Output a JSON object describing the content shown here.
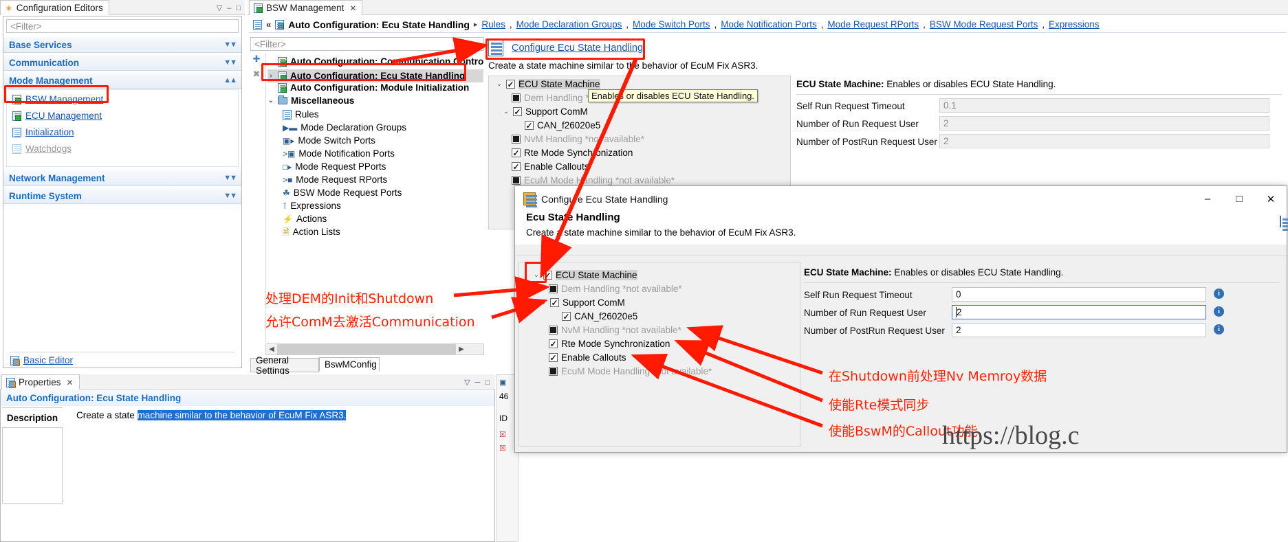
{
  "app": {
    "watermark": "https://blog.c"
  },
  "config_editors_view": {
    "tab_label": "Configuration Editors",
    "tab_icon": "star-icon",
    "filter_placeholder": "<Filter>",
    "minimize_label": "–",
    "maximize_label": "□",
    "menu_label": "▽",
    "categories": [
      {
        "label": "Base Services",
        "expanded": false
      },
      {
        "label": "Communication",
        "expanded": false
      },
      {
        "label": "Mode Management",
        "expanded": true
      },
      {
        "label": "Network Management",
        "expanded": false
      },
      {
        "label": "Runtime System",
        "expanded": false
      }
    ],
    "mode_management_items": [
      {
        "label": "BSW Management",
        "icon": "bsw-management-icon",
        "enabled": true,
        "highlighted": true
      },
      {
        "label": "ECU Management",
        "icon": "ecu-management-icon",
        "enabled": true,
        "highlighted": false
      },
      {
        "label": "Initialization",
        "icon": "initialization-icon",
        "enabled": true,
        "highlighted": false
      },
      {
        "label": "Watchdogs",
        "icon": "watchdogs-icon",
        "enabled": false,
        "highlighted": false
      }
    ],
    "basic_editor_label": "Basic Editor"
  },
  "editor": {
    "tab_label": "BSW Management",
    "tab_icon": "bsw-management-icon",
    "breadcrumb": {
      "back_label": "«",
      "title": "Auto Configuration: Ecu State Handling",
      "separator": "▸",
      "links": [
        "Rules",
        "Mode Declaration Groups",
        "Mode Switch Ports",
        "Mode Notification Ports",
        "Mode Request RPorts",
        "BSW Mode Request Ports",
        "Expressions"
      ]
    },
    "filter_placeholder": "<Filter>",
    "toolbar": {
      "add_label": "✚",
      "delete_label": "✖"
    },
    "tree": [
      {
        "label": "Auto Configuration: Communication Control",
        "icon": "auto-config-icon",
        "bold": true,
        "indent": 0,
        "twisty": "",
        "selected": false
      },
      {
        "label": "Auto Configuration: Ecu State Handling",
        "icon": "auto-config-icon",
        "bold": true,
        "indent": 0,
        "twisty": "›",
        "selected": true
      },
      {
        "label": "Auto Configuration: Module Initialization",
        "icon": "auto-config-icon",
        "bold": true,
        "indent": 0,
        "twisty": "",
        "selected": false
      },
      {
        "label": "Miscellaneous",
        "icon": "folder-icon",
        "bold": true,
        "indent": 0,
        "twisty": "⌄",
        "selected": false
      },
      {
        "label": "Rules",
        "icon": "rules-icon",
        "bold": false,
        "indent": 1,
        "twisty": "",
        "selected": false
      },
      {
        "label": "Mode Declaration Groups",
        "icon": "mode-declaration-groups-icon",
        "bold": false,
        "indent": 1,
        "twisty": "",
        "selected": false
      },
      {
        "label": "Mode Switch Ports",
        "icon": "mode-switch-ports-icon",
        "bold": false,
        "indent": 1,
        "twisty": "",
        "selected": false
      },
      {
        "label": "Mode Notification Ports",
        "icon": "mode-notification-ports-icon",
        "bold": false,
        "indent": 1,
        "twisty": "",
        "selected": false
      },
      {
        "label": "Mode Request PPorts",
        "icon": "mode-request-pports-icon",
        "bold": false,
        "indent": 1,
        "twisty": "",
        "selected": false
      },
      {
        "label": "Mode Request RPorts",
        "icon": "mode-request-rports-icon",
        "bold": false,
        "indent": 1,
        "twisty": "",
        "selected": false
      },
      {
        "label": "BSW Mode Request Ports",
        "icon": "bsw-mode-request-ports-icon",
        "bold": false,
        "indent": 1,
        "twisty": "",
        "selected": false
      },
      {
        "label": "Expressions",
        "icon": "expressions-icon",
        "bold": false,
        "indent": 1,
        "twisty": "",
        "selected": false
      },
      {
        "label": "Actions",
        "icon": "actions-icon",
        "bold": false,
        "indent": 1,
        "twisty": "",
        "selected": false
      },
      {
        "label": "Action Lists",
        "icon": "action-lists-icon",
        "bold": false,
        "indent": 1,
        "twisty": "",
        "selected": false
      }
    ],
    "bottom_tabs": [
      {
        "label": "General Settings",
        "active": false
      },
      {
        "label": "BswMConfig",
        "active": true
      }
    ],
    "detail": {
      "configure_link": "Configure Ecu State Handling",
      "description": "Create a state machine similar to the behavior of EcuM Fix ASR3.",
      "tooltip": "Enables or disables ECU State Handling.",
      "tree": [
        {
          "label": "ECU State Machine",
          "state": "checked",
          "indent": 0,
          "twisty": "⌄",
          "enabled": true,
          "selected": true
        },
        {
          "label": "Dem Handling *not available*",
          "state": "filled",
          "indent": 1,
          "twisty": "",
          "enabled": false,
          "selected": false
        },
        {
          "label": "Support ComM",
          "state": "checked",
          "indent": 1,
          "twisty": "⌄",
          "enabled": true,
          "selected": false
        },
        {
          "label": "CAN_f26020e5",
          "state": "checked",
          "indent": 2,
          "twisty": "",
          "enabled": true,
          "selected": false
        },
        {
          "label": "NvM Handling *not available*",
          "state": "filled",
          "indent": 1,
          "twisty": "",
          "enabled": false,
          "selected": false
        },
        {
          "label": "Rte Mode Synchronization",
          "state": "checked",
          "indent": 1,
          "twisty": "",
          "enabled": true,
          "selected": false
        },
        {
          "label": "Enable Callouts",
          "state": "checked",
          "indent": 1,
          "twisty": "",
          "enabled": true,
          "selected": false
        },
        {
          "label": "EcuM Mode Handling *not available*",
          "state": "filled",
          "indent": 1,
          "twisty": "",
          "enabled": false,
          "selected": false
        }
      ],
      "props_header_bold": "ECU State Machine:",
      "props_header_rest": " Enables or disables ECU State Handling.",
      "props": [
        {
          "label": "Self Run Request Timeout",
          "value": "0.1",
          "readonly": true
        },
        {
          "label": "Number of Run Request User",
          "value": "2",
          "readonly": true
        },
        {
          "label": "Number of PostRun Request User",
          "value": "2",
          "readonly": true
        }
      ]
    }
  },
  "properties_view": {
    "tab_label": "Properties",
    "title": "Auto Configuration: Ecu State Handling",
    "section_label": "Description",
    "description_plain": "Create a state ",
    "description_selected": "machine similar to the behavior of EcuM Fix ASR3."
  },
  "dialog": {
    "title": "Configure Ecu State Handling",
    "title_icon": "cfg-icon",
    "minimize_label": "–",
    "maximize_label": "□",
    "close_label": "✕",
    "heading": "Ecu State Handling",
    "subheading": "Create a state machine similar to the behavior of EcuM Fix ASR3.",
    "tree": [
      {
        "label": "ECU State Machine",
        "state": "checked",
        "indent": 0,
        "twisty": "⌄",
        "enabled": true,
        "selected": true
      },
      {
        "label": "Dem Handling *not available*",
        "state": "filled",
        "indent": 1,
        "twisty": "",
        "enabled": false,
        "selected": false
      },
      {
        "label": "Support ComM",
        "state": "checked",
        "indent": 1,
        "twisty": "⌄",
        "enabled": true,
        "selected": false
      },
      {
        "label": "CAN_f26020e5",
        "state": "checked",
        "indent": 2,
        "twisty": "",
        "enabled": true,
        "selected": false
      },
      {
        "label": "NvM Handling *not available*",
        "state": "filled",
        "indent": 1,
        "twisty": "",
        "enabled": false,
        "selected": false
      },
      {
        "label": "Rte Mode Synchronization",
        "state": "checked",
        "indent": 1,
        "twisty": "",
        "enabled": true,
        "selected": false
      },
      {
        "label": "Enable Callouts",
        "state": "checked",
        "indent": 1,
        "twisty": "",
        "enabled": true,
        "selected": false
      },
      {
        "label": "EcuM Mode Handling *not available*",
        "state": "filled",
        "indent": 1,
        "twisty": "",
        "enabled": false,
        "selected": false
      }
    ],
    "props_header_bold": "ECU State Machine:",
    "props_header_rest": " Enables or disables ECU State Handling.",
    "props": [
      {
        "label": "Self Run Request Timeout",
        "value": "0",
        "focused": false
      },
      {
        "label": "Number of Run Request User",
        "value": "2",
        "focused": true
      },
      {
        "label": "Number of PostRun Request User",
        "value": "2",
        "focused": false
      }
    ]
  },
  "annotations": [
    {
      "id": "anno-dem",
      "text": "处理DEM的Init和Shutdown"
    },
    {
      "id": "anno-comm",
      "text": "允许ComM去激活Communication"
    },
    {
      "id": "anno-nvm",
      "text": "在Shutdown前处理Nv Memroy数据"
    },
    {
      "id": "anno-rte",
      "text": "使能Rte模式同步"
    },
    {
      "id": "anno-callout",
      "text": "使能BswM的Callout功能"
    }
  ],
  "side_strip": {
    "label_46": "46",
    "label_id": "ID"
  },
  "colors": {
    "link": "#1d54a7",
    "category": "#1a6bbd",
    "annotation": "#ff2200",
    "selection": "#1f6fd0"
  }
}
